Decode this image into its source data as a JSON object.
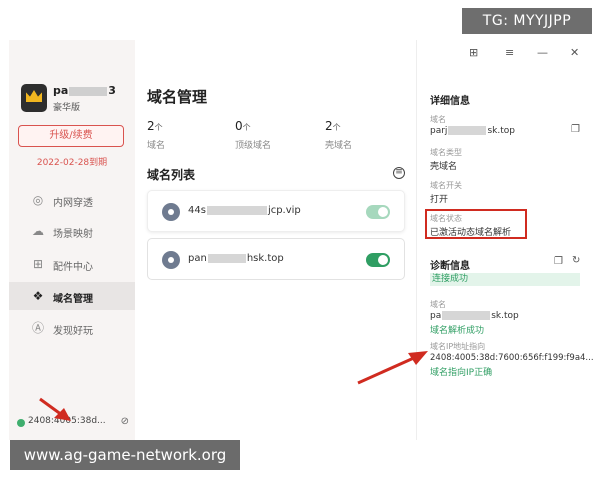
{
  "watermark_top": "TG: MYYJJPP",
  "watermark_bottom": "www.ag-game-network.org",
  "window_controls": {
    "pin": "⊞",
    "menu": "≡",
    "minimize": "—",
    "close": "✕"
  },
  "sidebar": {
    "username_prefix": "pa",
    "username_suffix": "3",
    "member_level": "豪华版",
    "upgrade_label": "升级/续费",
    "expire_text": "2022-02-28到期",
    "items": [
      {
        "label": "内网穿透",
        "icon": "globe-icon"
      },
      {
        "label": "场景映射",
        "icon": "cloud-icon"
      },
      {
        "label": "配件中心",
        "icon": "grid-icon"
      },
      {
        "label": "域名管理",
        "icon": "domain-icon",
        "active": true
      },
      {
        "label": "发现好玩",
        "icon": "discover-icon"
      }
    ],
    "ip_text": "2408:4005:38d...",
    "status_color": "#3fae6e"
  },
  "main": {
    "title": "域名管理",
    "stats": [
      {
        "num": "2",
        "unit": "个",
        "label": "域名"
      },
      {
        "num": "0",
        "unit": "个",
        "label": "顶级域名"
      },
      {
        "num": "2",
        "unit": "个",
        "label": "壳域名"
      }
    ],
    "list_title": "域名列表",
    "domains": [
      {
        "prefix": "44s",
        "suffix": "jcp.vip",
        "enabled": true
      },
      {
        "prefix": "pan",
        "suffix": "hsk.top",
        "enabled": true
      }
    ]
  },
  "detail": {
    "title": "详细信息",
    "domain_label": "域名",
    "domain_prefix": "parj",
    "domain_suffix": "sk.top",
    "type_label": "域名类型",
    "type_value": "壳域名",
    "switch_label": "域名开关",
    "switch_value": "打开",
    "status_label": "域名状态",
    "status_value": "已激活动态域名解析",
    "diag_title": "诊断信息",
    "diag_badge": "连接成功",
    "diag_domain_label": "域名",
    "diag_domain_prefix": "pa",
    "diag_domain_suffix": "sk.top",
    "diag_domain_status": "域名解析成功",
    "ip_label": "域名IP地址指向",
    "ip_value": "2408:4005:38d:7600:656f:f199:f9a4...",
    "ip_status": "域名指向IP正确"
  },
  "colors": {
    "accent": "#2f9e63",
    "alert": "#d02b20",
    "upgrade": "#d9534f"
  }
}
